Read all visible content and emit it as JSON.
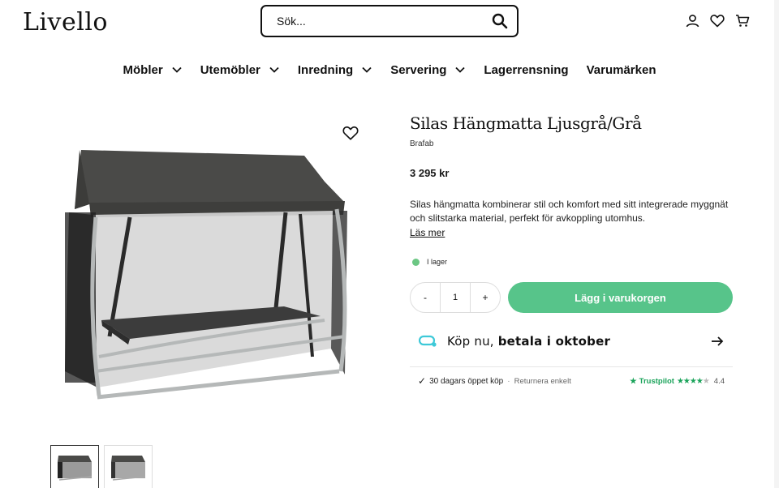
{
  "header": {
    "logo": "Livello",
    "search_placeholder": "Sök..."
  },
  "nav": [
    {
      "label": "Möbler",
      "dropdown": true
    },
    {
      "label": "Utemöbler",
      "dropdown": true
    },
    {
      "label": "Inredning",
      "dropdown": true
    },
    {
      "label": "Servering",
      "dropdown": true
    },
    {
      "label": "Lagerrensning",
      "dropdown": false
    },
    {
      "label": "Varumärken",
      "dropdown": false
    }
  ],
  "product": {
    "title": "Silas Hängmatta Ljusgrå/Grå",
    "brand": "Brafab",
    "price": "3 295 kr",
    "description": "Silas hängmatta kombinerar stil och komfort med sitt integrerade myggnät och slitstarka material, perfekt för avkoppling utomhus.",
    "read_more": "Läs mer",
    "stock": "I lager",
    "stock_color": "#6cc784",
    "quantity": "1",
    "minus": "-",
    "plus": "+",
    "add_to_cart": "Lägg i varukorgen",
    "accent_color": "#57c48a"
  },
  "klarna": {
    "prefix": "Köp nu, ",
    "bold": "betala i oktober"
  },
  "trust": {
    "returns": "30 dagars öppet köp",
    "returns_easy": "Returnera enkelt",
    "trustpilot": "Trustpilot",
    "rating": "4.4"
  }
}
